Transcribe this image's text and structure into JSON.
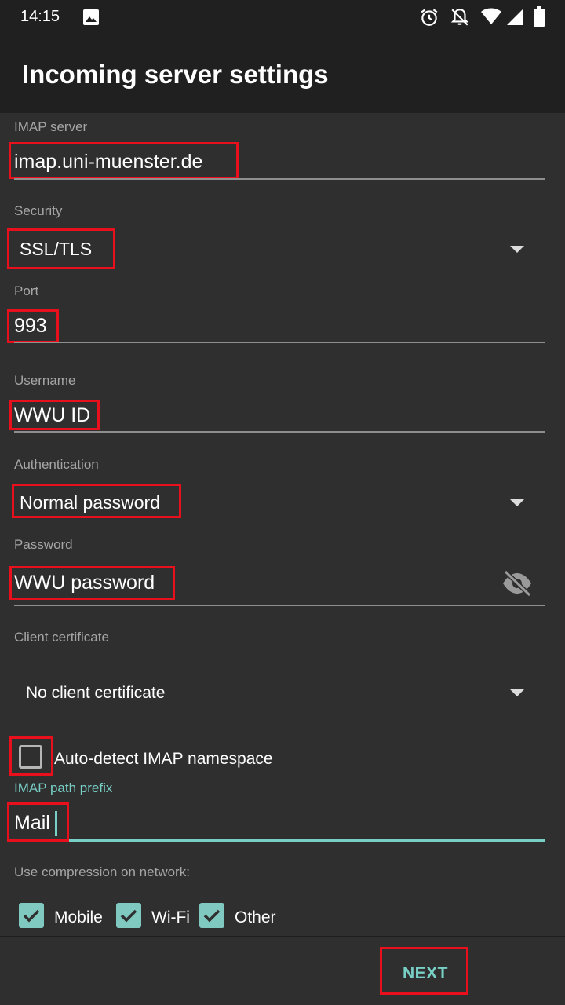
{
  "status_bar": {
    "time": "14:15"
  },
  "app_bar": {
    "title": "Incoming server settings"
  },
  "form": {
    "imap_server": {
      "label": "IMAP server",
      "value": "imap.uni-muenster.de"
    },
    "security": {
      "label": "Security",
      "value": "SSL/TLS"
    },
    "port": {
      "label": "Port",
      "value": "993"
    },
    "username": {
      "label": "Username",
      "value": "WWU ID"
    },
    "authentication": {
      "label": "Authentication",
      "value": "Normal password"
    },
    "password": {
      "label": "Password",
      "value": "WWU password"
    },
    "client_certificate": {
      "label": "Client certificate",
      "value": "No client certificate"
    },
    "auto_detect": {
      "label": "Auto-detect IMAP namespace",
      "checked": false
    },
    "path_prefix": {
      "label": "IMAP path prefix",
      "value": "Mail"
    },
    "compression": {
      "label": "Use compression on network:",
      "options": [
        {
          "label": "Mobile",
          "checked": true
        },
        {
          "label": "Wi-Fi",
          "checked": true
        },
        {
          "label": "Other",
          "checked": true
        }
      ]
    }
  },
  "footer": {
    "next_label": "NEXT"
  },
  "colors": {
    "accent": "#78cfc6",
    "highlight": "#e8101c",
    "background": "#2f2f2f",
    "bar": "#202020"
  },
  "icons": [
    "image-icon",
    "alarm-icon",
    "notifications-off-icon",
    "wifi-icon",
    "signal-icon",
    "battery-icon",
    "visibility-off-icon",
    "dropdown-arrow-icon",
    "check-icon"
  ]
}
